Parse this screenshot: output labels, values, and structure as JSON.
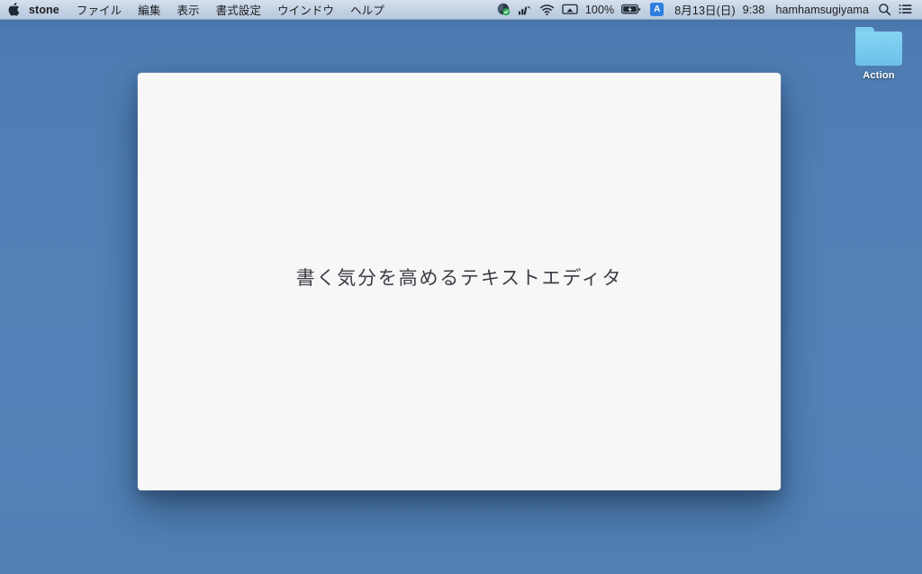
{
  "menubar": {
    "apple_icon": "apple-logo-icon",
    "app_menus": [
      {
        "label": "stone",
        "name": "menu-app-stone",
        "bold": true
      },
      {
        "label": "ファイル",
        "name": "menu-file"
      },
      {
        "label": "編集",
        "name": "menu-edit"
      },
      {
        "label": "表示",
        "name": "menu-view"
      },
      {
        "label": "書式設定",
        "name": "menu-format"
      },
      {
        "label": "ウインドウ",
        "name": "menu-window"
      },
      {
        "label": "ヘルプ",
        "name": "menu-help"
      }
    ],
    "status": {
      "dropbox_icon": "dropbox-globe-icon",
      "signal_icon": "signal-strength-icon",
      "wifi_icon": "wifi-icon",
      "airplay_icon": "airplay-display-icon",
      "battery_percent": "100%",
      "battery_icon": "battery-charging-icon",
      "input_source": "A",
      "date": "8月13日(日)",
      "time": "9:38",
      "user": "hamhamsugiyama",
      "search_icon": "spotlight-search-icon",
      "notification_icon": "notification-center-icon"
    }
  },
  "desktop": {
    "background_color": "#5180b6",
    "icons": [
      {
        "label": "Action",
        "name": "desktop-folder-action",
        "color": "#7bcaee"
      }
    ]
  },
  "editor": {
    "document_text": "書く気分を高めるテキストエディタ",
    "paper_color": "#f7f7f7",
    "text_color": "#3c3c46"
  }
}
